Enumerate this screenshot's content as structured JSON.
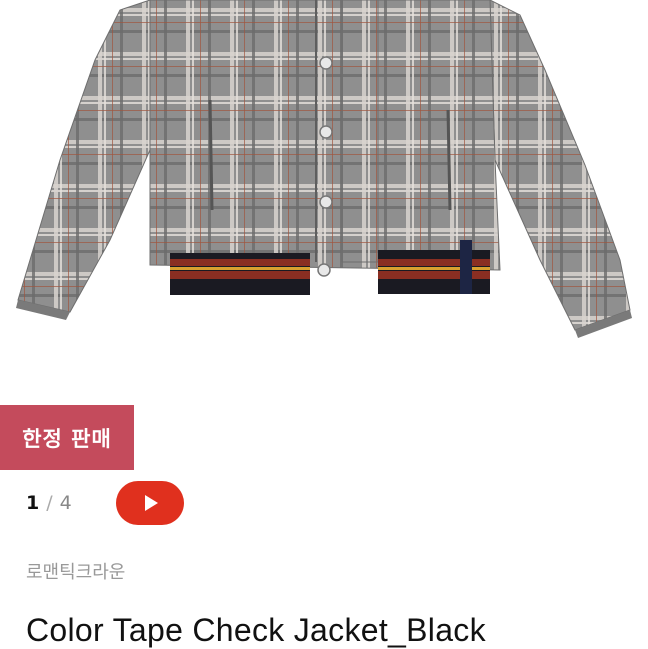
{
  "badge": {
    "label": "한정 판매",
    "color": "#c44b5c"
  },
  "gallery": {
    "current": "1",
    "separator": "/",
    "total": "4"
  },
  "video": {
    "icon": "play-icon",
    "color": "#e0301e"
  },
  "product": {
    "brand": "로맨틱크라운",
    "title": "Color Tape Check Jacket_Black",
    "image_icon": "plaid-jacket-photo"
  }
}
